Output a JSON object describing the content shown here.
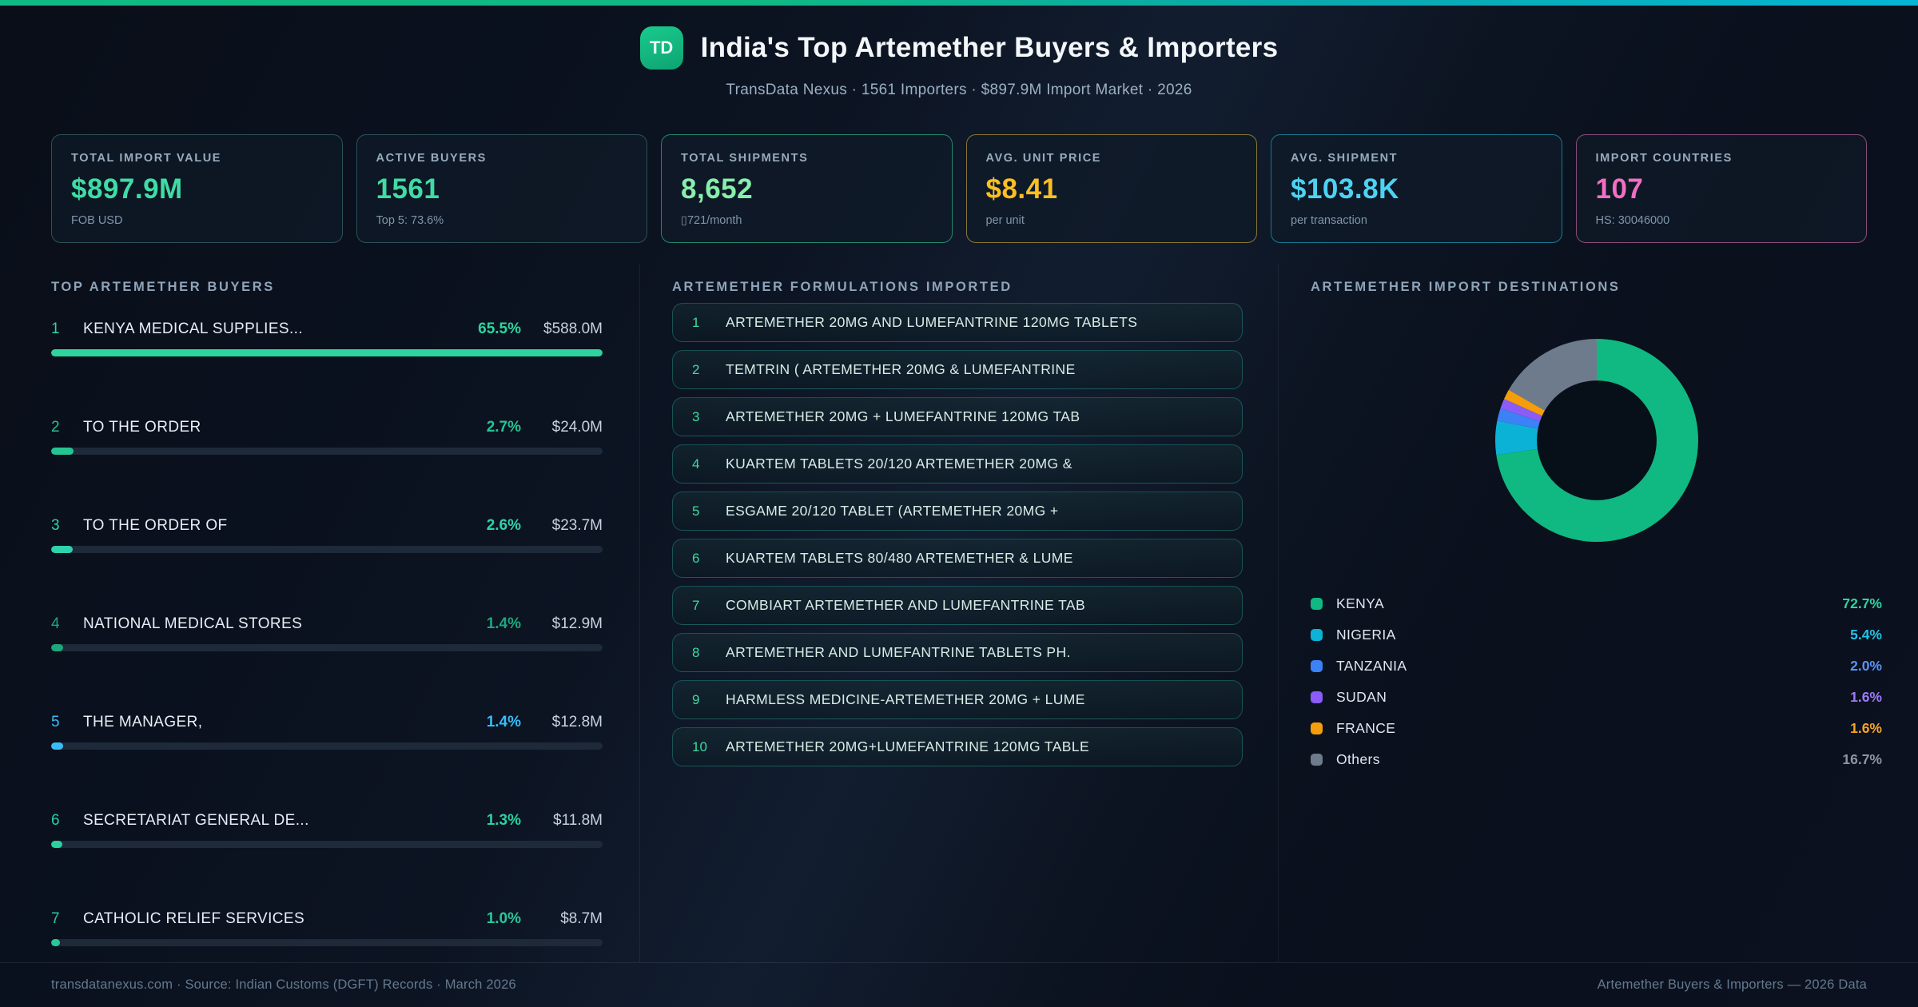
{
  "theme": {
    "topbar_from": "#10b981",
    "topbar_mid": "#0aa9ad",
    "topbar_to": "#06b6d4",
    "accent_green": "#34d399",
    "accent_cyan": "#38bdf8",
    "accent_amber": "#fbbf24",
    "accent_pink": "#f472b6"
  },
  "header": {
    "logo": "TD",
    "title": "India's Top Artemether Buyers & Importers",
    "subtitle": "TransData Nexus · 1561 Importers · $897.9M Import Market · 2026"
  },
  "stats": [
    {
      "label": "TOTAL IMPORT VALUE",
      "value": "$897.9M",
      "sub": "FOB USD",
      "color": "#3fdca4",
      "border": "rgba(90,170,165,0.40)"
    },
    {
      "label": "ACTIVE BUYERS",
      "value": "1561",
      "sub": "Top 5: 73.6%",
      "color": "#3fdca4",
      "border": "rgba(90,170,165,0.40)"
    },
    {
      "label": "TOTAL SHIPMENTS",
      "value": "8,652",
      "sub": "▯721/month",
      "color": "#86efac",
      "border": "rgba(52,211,153,0.60)"
    },
    {
      "label": "AVG. UNIT PRICE",
      "value": "$8.41",
      "sub": "per unit",
      "color": "#fbbf24",
      "border": "rgba(202,168,60,0.65)"
    },
    {
      "label": "AVG. SHIPMENT",
      "value": "$103.8K",
      "sub": "per transaction",
      "color": "#4dd2f2",
      "border": "rgba(34,184,212,0.60)"
    },
    {
      "label": "IMPORT COUNTRIES",
      "value": "107",
      "sub": "HS: 30046000",
      "color": "#f26ec4",
      "border": "rgba(219,112,178,0.60)"
    }
  ],
  "buyers": {
    "title": "TOP ARTEMETHER BUYERS",
    "max_pct": 65.5,
    "rows": [
      {
        "rank": "1",
        "name": "KENYA MEDICAL SUPPLIES...",
        "pct": "65.5%",
        "pct_num": 65.5,
        "value": "$588.0M",
        "color": "#2dd49e"
      },
      {
        "rank": "2",
        "name": "TO THE ORDER",
        "pct": "2.7%",
        "pct_num": 2.7,
        "value": "$24.0M",
        "color": "#24c493"
      },
      {
        "rank": "3",
        "name": "TO THE ORDER OF",
        "pct": "2.6%",
        "pct_num": 2.6,
        "value": "$23.7M",
        "color": "#2cd3ab"
      },
      {
        "rank": "4",
        "name": "NATIONAL MEDICAL STORES",
        "pct": "1.4%",
        "pct_num": 1.4,
        "value": "$12.9M",
        "color": "#1ca87c"
      },
      {
        "rank": "5",
        "name": "THE MANAGER,",
        "pct": "1.4%",
        "pct_num": 1.4,
        "value": "$12.8M",
        "color": "#38bdf8"
      },
      {
        "rank": "6",
        "name": "SECRETARIAT GENERAL DE...",
        "pct": "1.3%",
        "pct_num": 1.3,
        "value": "$11.8M",
        "color": "#2bd0a0"
      },
      {
        "rank": "7",
        "name": "CATHOLIC RELIEF SERVICES",
        "pct": "1.0%",
        "pct_num": 1.0,
        "value": "$8.7M",
        "color": "#29c79a"
      }
    ]
  },
  "formulations": {
    "title": "ARTEMETHER FORMULATIONS IMPORTED",
    "items": [
      {
        "num": "1",
        "text": "ARTEMETHER 20MG AND LUMEFANTRINE 120MG TABLETS"
      },
      {
        "num": "2",
        "text": "TEMTRIN ( ARTEMETHER 20MG & LUMEFANTRINE"
      },
      {
        "num": "3",
        "text": "ARTEMETHER 20MG + LUMEFANTRINE 120MG TAB"
      },
      {
        "num": "4",
        "text": "KUARTEM TABLETS 20/120 ARTEMETHER 20MG &"
      },
      {
        "num": "5",
        "text": "ESGAME 20/120 TABLET (ARTEMETHER 20MG +"
      },
      {
        "num": "6",
        "text": "KUARTEM TABLETS 80/480 ARTEMETHER & LUME"
      },
      {
        "num": "7",
        "text": "COMBIART ARTEMETHER AND LUMEFANTRINE TAB"
      },
      {
        "num": "8",
        "text": "ARTEMETHER AND LUMEFANTRINE TABLETS PH."
      },
      {
        "num": "9",
        "text": "HARMLESS MEDICINE-ARTEMETHER 20MG + LUME"
      },
      {
        "num": "10",
        "text": "ARTEMETHER 20MG+LUMEFANTRINE 120MG TABLE"
      }
    ]
  },
  "destinations": {
    "title": "ARTEMETHER IMPORT DESTINATIONS"
  },
  "chart_data": {
    "type": "pie",
    "subtype": "donut",
    "title": "ARTEMETHER IMPORT DESTINATIONS",
    "labels": [
      "KENYA",
      "NIGERIA",
      "TANZANIA",
      "SUDAN",
      "FRANCE",
      "Others"
    ],
    "values": [
      72.7,
      5.4,
      2.0,
      1.6,
      1.6,
      16.7
    ],
    "value_labels": [
      "72.7%",
      "5.4%",
      "2.0%",
      "1.6%",
      "1.6%",
      "16.7%"
    ],
    "colors": [
      "#10b981",
      "#0cb2d6",
      "#3b82f6",
      "#8b5cf6",
      "#f59e0b",
      "#6e7b8c"
    ],
    "value_text_colors": [
      "#2dd4a0",
      "#22c3e6",
      "#5b93f5",
      "#9d7bf8",
      "#f5a623",
      "#8b97a6"
    ],
    "start_angle_deg": 0,
    "direction": "clockwise",
    "inner_ratio": 0.59,
    "hole_fill": "#071019",
    "legend_position": "bottom-left-labels-right-values"
  },
  "footer": {
    "left": "transdatanexus.com · Source: Indian Customs (DGFT) Records · March 2026",
    "right": "Artemether Buyers & Importers — 2026 Data"
  }
}
